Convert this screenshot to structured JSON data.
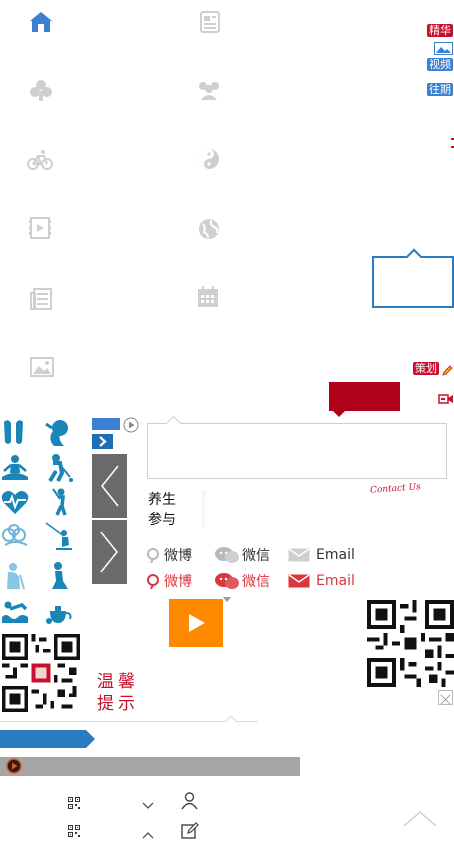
{
  "tags": {
    "featured": "精华",
    "video": "视频",
    "past": "往期",
    "plan": "策划"
  },
  "sidebar": {
    "health": "养生",
    "participate": "参与"
  },
  "share_gray": {
    "weibo": "微博",
    "wechat": "微信",
    "email": "Email"
  },
  "share_red": {
    "weibo": "微博",
    "wechat": "微信",
    "email": "Email"
  },
  "contact_script": "Contact Us",
  "warm_tip": "温馨提示",
  "colors": {
    "accent_blue": "#2a7bbf",
    "red": "#c8102e",
    "orange": "#ff8a00",
    "icon_gray": "#cfcfcf",
    "health_icon_blue": "#1a86b8"
  },
  "icons": [
    "home-icon",
    "news-icon",
    "club-icon",
    "people-icon",
    "bicycle-icon",
    "yin-yang-icon",
    "film-icon",
    "globe-icon",
    "newspaper-icon",
    "calendar-icon",
    "image-icon"
  ]
}
